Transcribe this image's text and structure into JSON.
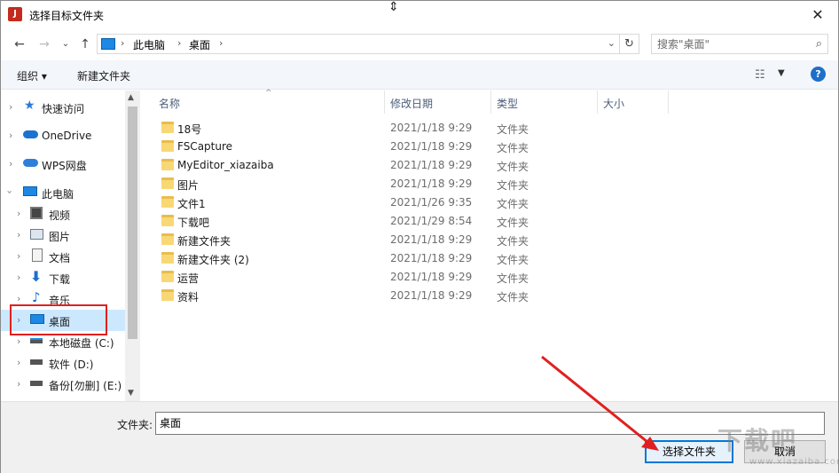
{
  "window": {
    "title": "选择目标文件夹",
    "close_glyph": "✕",
    "app_icon_glyph": "J"
  },
  "address_bar": {
    "crumbs": [
      "此电脑",
      "桌面"
    ],
    "search_placeholder": "搜索\"桌面\""
  },
  "toolbar": {
    "organize": "组织 ▾",
    "new_folder": "新建文件夹",
    "help": "?"
  },
  "nav": {
    "items": [
      {
        "label": "快速访问",
        "icon": "star-icon"
      },
      {
        "label": "OneDrive",
        "icon": "cloud-icon"
      },
      {
        "label": "WPS网盘",
        "icon": "cloud-icon"
      },
      {
        "label": "此电脑",
        "icon": "computer-icon"
      },
      {
        "label": "视频",
        "icon": "video-icon"
      },
      {
        "label": "图片",
        "icon": "picture-icon"
      },
      {
        "label": "文档",
        "icon": "document-icon"
      },
      {
        "label": "下载",
        "icon": "download-icon"
      },
      {
        "label": "音乐",
        "icon": "music-icon"
      },
      {
        "label": "桌面",
        "icon": "desktop-icon"
      },
      {
        "label": "本地磁盘 (C:)",
        "icon": "drive-icon"
      },
      {
        "label": "软件 (D:)",
        "icon": "drive-icon"
      },
      {
        "label": "备份[勿删] (E:)",
        "icon": "drive-icon"
      }
    ]
  },
  "columns": {
    "name": "名称",
    "date": "修改日期",
    "type": "类型",
    "size": "大小"
  },
  "files": [
    {
      "name": "18号",
      "date": "2021/1/18 9:29",
      "type": "文件夹"
    },
    {
      "name": "FSCapture",
      "date": "2021/1/18 9:29",
      "type": "文件夹"
    },
    {
      "name": "MyEditor_xiazaiba",
      "date": "2021/1/18 9:29",
      "type": "文件夹"
    },
    {
      "name": "图片",
      "date": "2021/1/18 9:29",
      "type": "文件夹"
    },
    {
      "name": "文件1",
      "date": "2021/1/26 9:35",
      "type": "文件夹"
    },
    {
      "name": "下载吧",
      "date": "2021/1/29 8:54",
      "type": "文件夹"
    },
    {
      "name": "新建文件夹",
      "date": "2021/1/18 9:29",
      "type": "文件夹"
    },
    {
      "name": "新建文件夹 (2)",
      "date": "2021/1/18 9:29",
      "type": "文件夹"
    },
    {
      "name": "运营",
      "date": "2021/1/18 9:29",
      "type": "文件夹"
    },
    {
      "name": "资料",
      "date": "2021/1/18 9:29",
      "type": "文件夹"
    }
  ],
  "bottom": {
    "folder_label": "文件夹:",
    "folder_value": "桌面",
    "select_button": "选择文件夹",
    "cancel_button": "取消"
  },
  "watermark": {
    "text": "下载吧",
    "sub": "www.xiazaiba.com"
  },
  "colors": {
    "selection": "#cce8ff",
    "accent": "#0078d7",
    "annotation": "#e02020",
    "folder": "#f8d775"
  }
}
